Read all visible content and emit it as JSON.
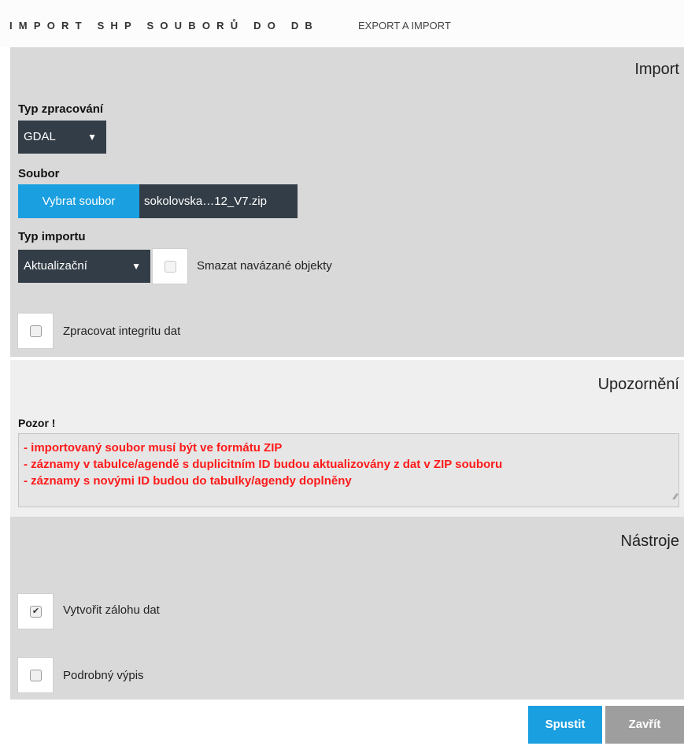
{
  "header": {
    "title": "IMPORT SHP SOUBORŮ DO DB",
    "subtitle": "EXPORT A IMPORT"
  },
  "import_panel": {
    "title": "Import",
    "processing_type_label": "Typ zpracování",
    "processing_type_value": "GDAL",
    "file_label": "Soubor",
    "file_button": "Vybrat soubor",
    "file_name": "sokolovska…12_V7.zip",
    "import_type_label": "Typ importu",
    "import_type_value": "Aktualizační",
    "delete_linked_label": "Smazat navázané objekty",
    "integrity_label": "Zpracovat integritu dat"
  },
  "warning_panel": {
    "title": "Upozornění",
    "label": "Pozor !",
    "lines": [
      "- importovaný soubor musí být ve formátu ZIP",
      "- záznamy v tabulce/agendě s duplicitním ID budou aktualizovány z dat v ZIP souboru",
      "- záznamy s novými ID budou do tabulky/agendy doplněny"
    ]
  },
  "tools_panel": {
    "title": "Nástroje",
    "backup_label": "Vytvořit zálohu dat",
    "backup_checked": true,
    "verbose_label": "Podrobný výpis",
    "verbose_checked": false
  },
  "footer": {
    "run_button": "Spustit",
    "close_button": "Zavřít"
  },
  "colors": {
    "accent": "#1a9fe0",
    "dark": "#333d47",
    "warning_text": "#ff1a1a",
    "panel_gray": "#d9d9d9"
  }
}
